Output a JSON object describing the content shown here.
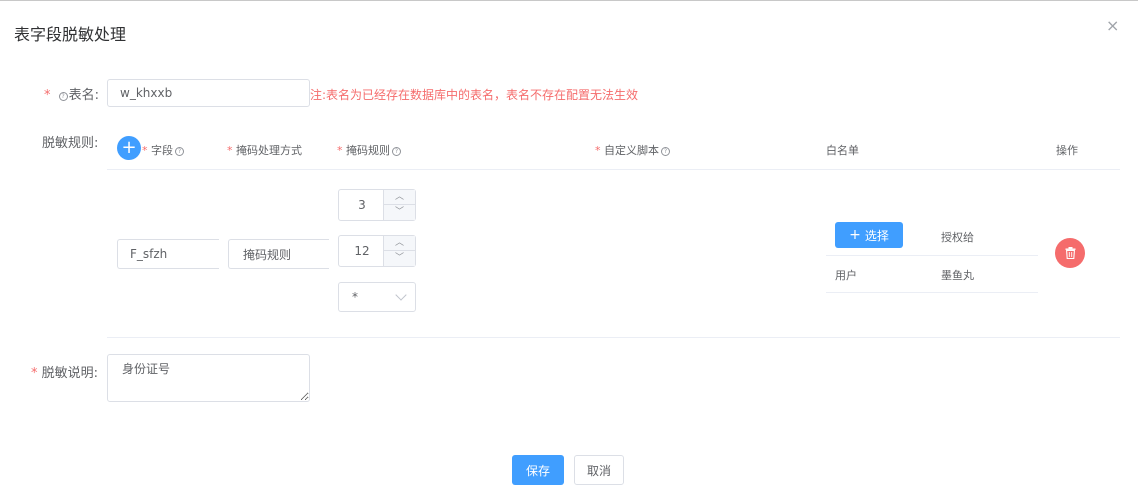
{
  "dialog": {
    "title": "表字段脱敏处理",
    "close_glyph": "×"
  },
  "form": {
    "required_mark": "*",
    "table_name": {
      "label": "表名:",
      "value": "w_khxxb",
      "hint": "注:表名为已经存在数据库中的表名，表名不存在配置无法生效"
    },
    "rules_label": "脱敏规则:",
    "description": {
      "label": "脱敏说明:",
      "value": "身份证号"
    }
  },
  "rules_table": {
    "headers": {
      "field": "字段",
      "mask_method": "掩码处理方式",
      "mask_rule": "掩码规则",
      "custom_script": "自定义脚本",
      "whitelist": "白名单",
      "actions": "操作"
    },
    "row": {
      "field": "F_sfzh",
      "mask_method": "掩码规则",
      "rule_num_1": "3",
      "rule_num_2": "12",
      "rule_char": "*"
    },
    "whitelist": {
      "select_label": "选择",
      "grant_to": "授权给",
      "entry_type": "用户",
      "entry_name": "墨鱼丸"
    }
  },
  "footer": {
    "save_label": "保存",
    "cancel_label": "取消"
  },
  "colors": {
    "primary": "#409eff",
    "danger": "#f56c6c",
    "border": "#dcdfe6"
  }
}
